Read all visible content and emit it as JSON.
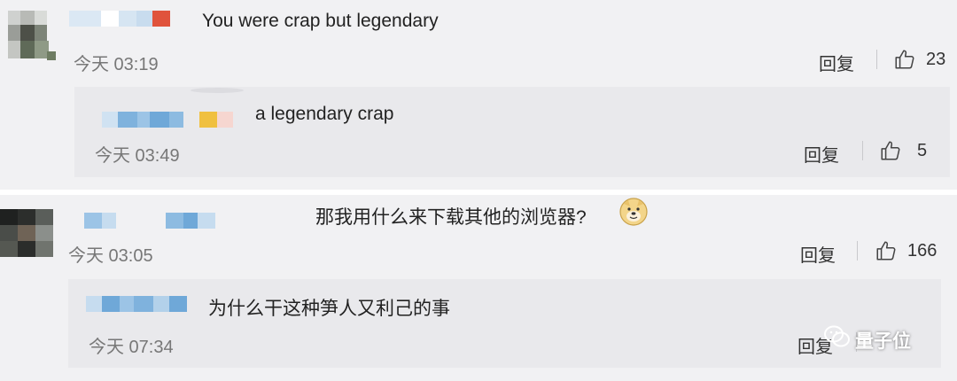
{
  "comments": [
    {
      "text": "You were crap but legendary",
      "time": "今天 03:19",
      "reply_label": "回复",
      "likes": "23",
      "reply": {
        "text": "a legendary crap",
        "time": "今天 03:49",
        "reply_label": "回复",
        "likes": "5"
      }
    },
    {
      "text": "那我用什么来下载其他的浏览器?",
      "emoji": "doge-emoji",
      "time": "今天 03:05",
      "reply_label": "回复",
      "likes": "166",
      "reply": {
        "text": "为什么干这种笋人又利己的事",
        "time": "今天 07:34",
        "reply_label": "回复"
      }
    }
  ],
  "watermark": "量子位",
  "colors": {
    "background": "#f1f1f3",
    "reply_background": "#e9e9ec",
    "mosaic_blue": "#6fa8d8",
    "mosaic_red": "#e0533c",
    "mosaic_yellow": "#f0c040"
  },
  "icons": [
    "thumbs-up-icon",
    "doge-emoji",
    "wechat-logo-icon"
  ]
}
